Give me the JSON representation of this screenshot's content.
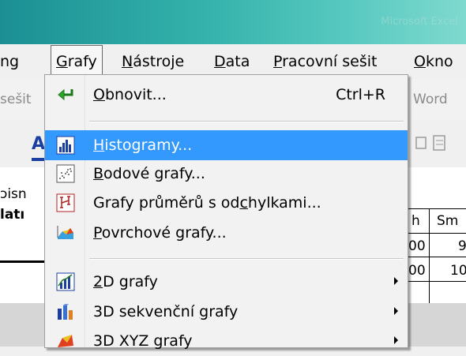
{
  "window": {
    "title": "Microsoft Excel"
  },
  "menubar": {
    "items": [
      {
        "label": "ng",
        "key": ""
      },
      {
        "label": "rafy",
        "key": "G"
      },
      {
        "label": "ástroje",
        "key": "N"
      },
      {
        "label": "ata",
        "key": "D"
      },
      {
        "label": "racovní sešit",
        "key": "P"
      },
      {
        "label": "kno",
        "key": "O"
      }
    ]
  },
  "toolbar": {
    "left_text": "sešit",
    "right_text": "Word"
  },
  "sheet": {
    "left_text_1": "ɔisn",
    "left_text_2": "latı",
    "col_h": "h",
    "col_sm": "Sm",
    "row1_a": "00",
    "row1_b": "9",
    "row2_a": "00",
    "row2_b": "10"
  },
  "menu": {
    "items": [
      {
        "pre": "",
        "key": "O",
        "post": "bnovit...",
        "shortcut": "Ctrl+R",
        "icon": "refresh-arrow-icon"
      },
      {
        "pre": "",
        "key": "H",
        "post": "istogramy...",
        "icon": "histogram-icon",
        "highlighted": true
      },
      {
        "pre": "",
        "key": "B",
        "post": "odové grafy...",
        "icon": "scatterplot-icon"
      },
      {
        "pre": "Grafy průměrů s od",
        "key": "c",
        "post": "hylkami...",
        "icon": "error-bar-icon"
      },
      {
        "pre": "",
        "key": "P",
        "post": "ovrchové grafy...",
        "icon": "surface-plot-icon"
      },
      {
        "pre": "",
        "key": "2",
        "post": "D grafy",
        "icon": "2d-graph-icon",
        "submenu": true
      },
      {
        "pre": "3D sekvenční ",
        "key": "g",
        "post": "rafy",
        "icon": "3d-sequential-graph-icon",
        "submenu": true
      },
      {
        "pre": "3D XYZ grafy",
        "key": "",
        "post": "",
        "icon": "3d-xyz-graph-icon",
        "submenu": true
      }
    ]
  },
  "colors": {
    "highlight": "#3399ff",
    "menu_bg": "#f2f2f2"
  }
}
